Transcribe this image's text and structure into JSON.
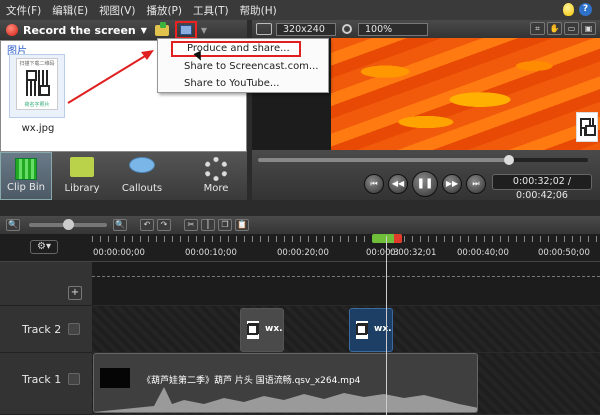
{
  "menu": [
    "文件(F)",
    "编辑(E)",
    "视图(V)",
    "播放(P)",
    "工具(T)",
    "帮助(H)"
  ],
  "record": {
    "label": "Record the screen"
  },
  "bin": {
    "header": "图片",
    "thumb_caption_top": "扫描下载二维码",
    "thumb_caption_bottom": "荷名字照片",
    "item_label": "wx.jpg"
  },
  "produce_menu": {
    "items": [
      "Produce and share...",
      "Share to Screencast.com...",
      "Share to YouTube..."
    ]
  },
  "tabs": [
    "Clip Bin",
    "Library",
    "Callouts",
    "More"
  ],
  "preview": {
    "dimensions": "320x240",
    "zoom": "100%",
    "timecode": "0:00:32;02 / 0:00:42;06",
    "scrub_progress": 0.76
  },
  "ruler": {
    "labels": [
      "00:00:00;00",
      "00:00:10;00",
      "00:00:20;00",
      "0:00:32;01",
      "00:00:40;00",
      "00:00:50;00"
    ],
    "playhead_partial": "00:00:3"
  },
  "tracks": [
    {
      "label": "Track 2",
      "clips": [
        "wx.",
        "wx."
      ]
    },
    {
      "label": "Track 1",
      "audio_title": "《葫芦娃第二季》葫芦 片头 国语流畅.qsv_x264.mp4"
    }
  ],
  "colors": {
    "accent_red": "#e02020",
    "playhead_green": "#6fbf3a",
    "selected_clip": "#1d3f66"
  }
}
